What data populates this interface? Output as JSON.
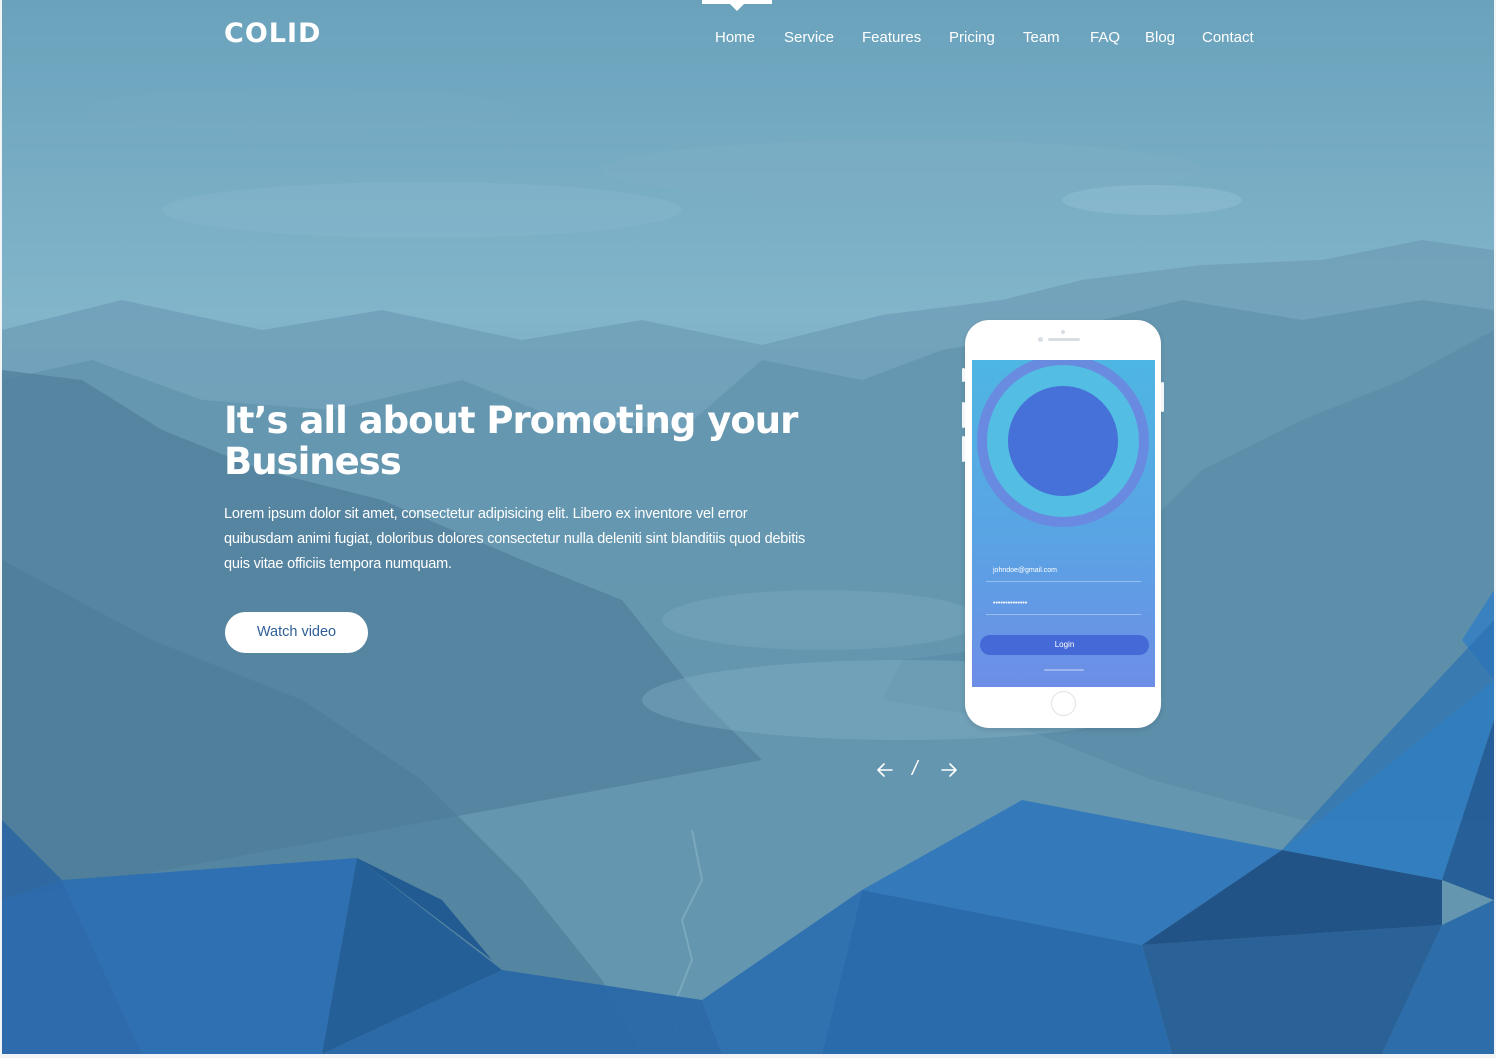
{
  "brand": {
    "logo": "COLID"
  },
  "nav": {
    "items": [
      {
        "label": "Home",
        "active": true
      },
      {
        "label": "Service",
        "active": false
      },
      {
        "label": "Features",
        "active": false
      },
      {
        "label": "Pricing",
        "active": false
      },
      {
        "label": "Team",
        "active": false
      },
      {
        "label": "FAQ",
        "active": false
      },
      {
        "label": "Blog",
        "active": false
      },
      {
        "label": "Contact",
        "active": false
      }
    ]
  },
  "hero": {
    "title": "It’s all about Promoting your Business",
    "text": "Lorem ipsum dolor sit amet, consectetur adipisicing elit. Libero ex inventore vel error quibusdam animi fugiat, doloribus dolores consectetur nulla deleniti sint blanditiis quod debitis quis vitae officiis tempora numquam.",
    "button_label": "Watch video"
  },
  "phone_screen": {
    "email": "johndoe@gmail.com",
    "password": "••••••••••••••",
    "login_label": "Login"
  },
  "slider": {
    "prev_icon": "arrow-left-icon",
    "separator": "/",
    "next_icon": "arrow-right-icon"
  },
  "colors": {
    "overlay": "#6fa5bf",
    "polygon_dark": "#1f5a97",
    "polygon_mid": "#2a6db0",
    "button_text": "#2f5f97"
  }
}
